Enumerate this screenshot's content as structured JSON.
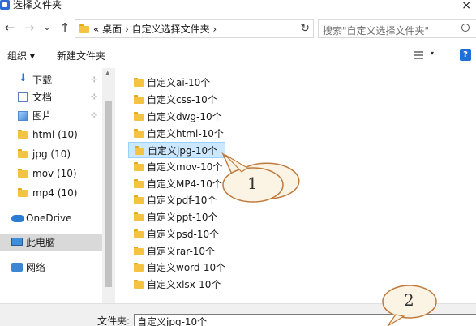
{
  "window": {
    "title": "选择文件夹",
    "close": "×"
  },
  "nav": {
    "back": "←",
    "forward": "→",
    "recent": "⌄",
    "up": "↑"
  },
  "address": {
    "path": "« 桌面 › 自定义选择文件夹 ›",
    "refresh": "↻"
  },
  "search": {
    "placeholder": "搜索\"自定义选择文件夹\""
  },
  "toolbar": {
    "organize": "组织 ▾",
    "new_folder": "新建文件夹",
    "view_arrow": "▾",
    "help": "?"
  },
  "sidebar": {
    "items": [
      {
        "label": "下载",
        "pinned": true
      },
      {
        "label": "文档",
        "pinned": true
      },
      {
        "label": "图片",
        "pinned": true
      },
      {
        "label": "html (10)"
      },
      {
        "label": "jpg (10)"
      },
      {
        "label": "mov (10)"
      },
      {
        "label": "mp4 (10)"
      },
      {
        "label": "OneDrive"
      },
      {
        "label": "此电脑"
      },
      {
        "label": "网络"
      }
    ],
    "pin_glyph": "⊹",
    "scroll_up": "▲"
  },
  "files": [
    "自定义ai-10个",
    "自定义css-10个",
    "自定义dwg-10个",
    "自定义html-10个",
    "自定义jpg-10个",
    "自定义mov-10个",
    "自定义MP4-10个",
    "自定义pdf-10个",
    "自定义ppt-10个",
    "自定义psd-10个",
    "自定义rar-10个",
    "自定义word-10个",
    "自定义xlsx-10个"
  ],
  "selected_file_index": 4,
  "filename": {
    "label": "文件夹:",
    "value": "自定义jpg-10个"
  },
  "annotations": {
    "one": "1",
    "two": "2"
  }
}
